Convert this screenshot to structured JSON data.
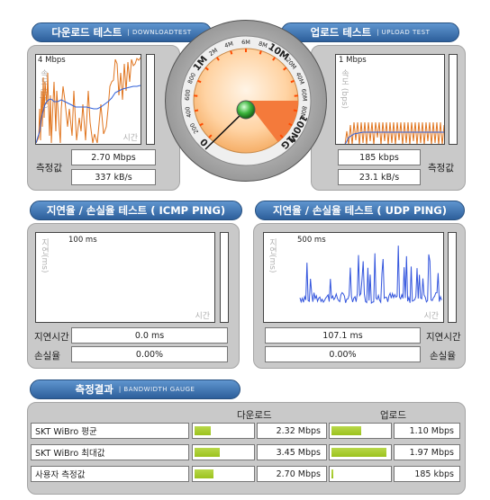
{
  "download": {
    "tab_title": "다운로드 테스트",
    "tab_sub": "| DOWNLOADTEST",
    "scale": "4 Mbps",
    "ylabel": "속도 (bps)",
    "xlabel": "시간",
    "result_label": "측정값",
    "speed_mbps": "2.70 Mbps",
    "speed_kbs": "337 kB/s"
  },
  "upload": {
    "tab_title": "업로드 테스트",
    "tab_sub": "| UPLOAD TEST",
    "scale": "1 Mbps",
    "ylabel": "속도 (bps)",
    "result_label": "측정값",
    "speed_kbps": "185 kbps",
    "speed_kbs": "23.1 kB/s"
  },
  "gauge": {
    "labels": [
      "0",
      "200",
      "400",
      "600",
      "800",
      "1M",
      "2M",
      "4M",
      "6M",
      "8M",
      "10M",
      "20M",
      "40M",
      "60M",
      "80M",
      "100M",
      "1G"
    ],
    "needle_value": "2.70 Mbps"
  },
  "icmp": {
    "tab_title": "지연율 / 손실율 테스트 ( ICMP PING)",
    "scale": "100 ms",
    "ylabel": "지연(ms)",
    "xlabel": "시간",
    "latency_label": "지연시간",
    "latency": "0.0 ms",
    "loss_label": "손실율",
    "loss": "0.00%"
  },
  "udp": {
    "tab_title": "지연율 / 손실율 테스트 ( UDP PING)",
    "scale": "500 ms",
    "ylabel": "지연(ms)",
    "xlabel": "시간",
    "latency_label": "지연시간",
    "latency": "107.1 ms",
    "loss_label": "손실율",
    "loss": "0.00%"
  },
  "results": {
    "tab_title": "측정결과",
    "tab_sub": "| BANDWIDTH GAUGE",
    "download_header": "다운로드",
    "upload_header": "업로드",
    "rows": [
      {
        "name": "SKT WiBro 평균",
        "down": "2.32 Mbps",
        "down_level": 0.32,
        "up": "1.10 Mbps",
        "up_level": 0.55
      },
      {
        "name": "SKT WiBro 최대값",
        "down": "3.45 Mbps",
        "down_level": 0.47,
        "up": "1.97 Mbps",
        "up_level": 0.96
      },
      {
        "name": "사용자 측정값",
        "down": "2.70 Mbps",
        "down_level": 0.37,
        "up": "185 kbps",
        "up_level": 0.09
      }
    ]
  },
  "colors": {
    "tab": "#3d73b3",
    "download_line": "#e0751f",
    "avg_line": "#2f5fd8",
    "udp_line": "#3355dd",
    "bar_fill": "#a8cc2a"
  }
}
